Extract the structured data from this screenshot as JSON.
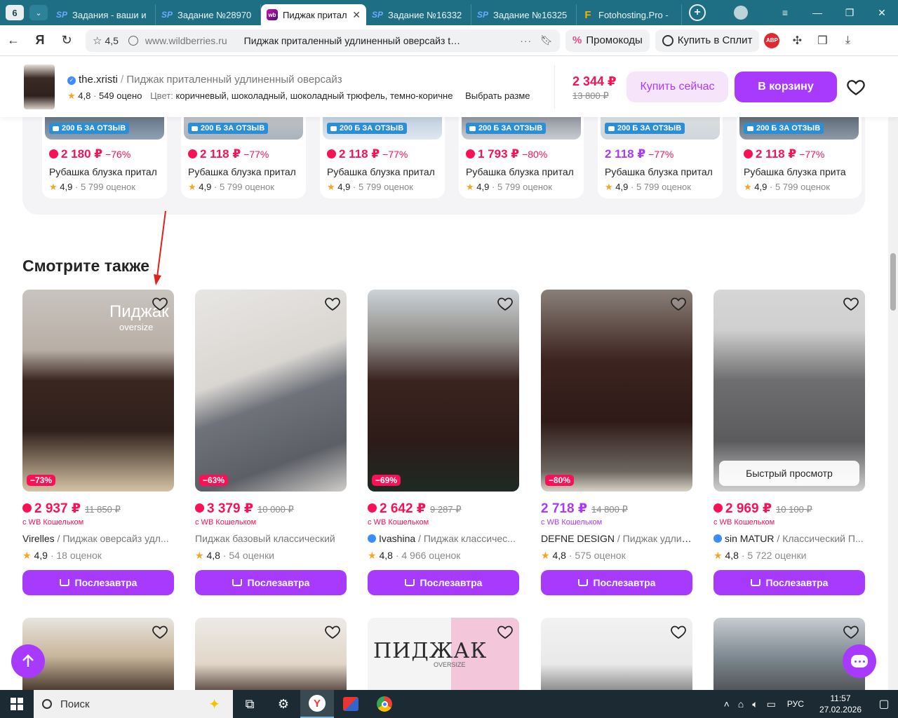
{
  "browser": {
    "tab_count": "6",
    "tabs": [
      {
        "icon": "SP",
        "title": "Задания - ваши и"
      },
      {
        "icon": "SP",
        "title": "Задание №28970"
      },
      {
        "icon": "wb",
        "title": "Пиджак притал"
      },
      {
        "icon": "SP",
        "title": "Задание №16332"
      },
      {
        "icon": "SP",
        "title": "Задание №16325"
      },
      {
        "icon": "F",
        "title": "Fotohosting.Pro -"
      }
    ],
    "site_rating": "4,5",
    "domain": "www.wildberries.ru",
    "page_title": "Пиджак приталенный удлиненный оверсайз t…",
    "promo_label": "Промокоды",
    "split_label": "Купить в Сплит",
    "abp_label": "ABP"
  },
  "sticky": {
    "brand": "the.xristi",
    "product_name": "Пиджак приталенный удлиненный оверсайз",
    "rating": "4,8",
    "reviews": "549 оцено",
    "color_label": "Цвет:",
    "colors": "коричневый, шоколадный, шоколадный трюфель, темно-коричне",
    "size_label": "Выбрать разме",
    "price": "2 344 ₽",
    "old_price": "13 800 ₽",
    "buy_now": "Купить сейчас",
    "to_cart": "В корзину"
  },
  "carousel": [
    {
      "badge": "200 Б ЗА ОТЗЫВ",
      "price": "2 180 ₽",
      "discount": "−76%",
      "name": "Рубашка блузка притал",
      "rating": "4,9",
      "reviews": "5 799 оценок",
      "wallet": true
    },
    {
      "badge": "200 Б ЗА ОТЗЫВ",
      "price": "2 118 ₽",
      "discount": "−77%",
      "name": "Рубашка блузка притал",
      "rating": "4,9",
      "reviews": "5 799 оценок",
      "wallet": true
    },
    {
      "badge": "200 Б ЗА ОТЗЫВ",
      "price": "2 118 ₽",
      "discount": "−77%",
      "name": "Рубашка блузка притал",
      "rating": "4,9",
      "reviews": "5 799 оценок",
      "wallet": true
    },
    {
      "badge": "200 Б ЗА ОТЗЫВ",
      "price": "1 793 ₽",
      "discount": "−80%",
      "name": "Рубашка блузка притал",
      "rating": "4,9",
      "reviews": "5 799 оценок",
      "wallet": true
    },
    {
      "badge": "200 Б ЗА ОТЗЫВ",
      "price": "2 118 ₽",
      "discount": "−77%",
      "name": "Рубашка блузка притал",
      "rating": "4,9",
      "reviews": "5 799 оценок",
      "wallet": false
    },
    {
      "badge": "200 Б ЗА ОТЗЫВ",
      "price": "2 118 ₽",
      "discount": "−77%",
      "name": "Рубашка блузка прита",
      "rating": "4,9",
      "reviews": "5 799 оценок",
      "wallet": true
    }
  ],
  "section_title": "Смотрите также",
  "products": [
    {
      "discount": "−73%",
      "price": "2 937 ₽",
      "old_price": "11 850 ₽",
      "wallet": "с WB Кошельком",
      "brand": "Virelles",
      "name": " / Пиджак оверсайз удл...",
      "verified": false,
      "rating": "4,9",
      "reviews": "18 оценок",
      "deliver": "Послезавтра",
      "overlay_title": "Пиджак",
      "overlay_sub": "oversize",
      "purple": false
    },
    {
      "discount": "−63%",
      "price": "3 379 ₽",
      "old_price": "10 000 ₽",
      "wallet": "с WB Кошельком",
      "brand": "",
      "name": "Пиджак базовый классический",
      "verified": false,
      "rating": "4,8",
      "reviews": "54 оценки",
      "deliver": "Послезавтра",
      "purple": false
    },
    {
      "discount": "−69%",
      "price": "2 642 ₽",
      "old_price": "9 287 ₽",
      "wallet": "с WB Кошельком",
      "brand": "Ivashina",
      "name": " / Пиджак классичес...",
      "verified": true,
      "rating": "4,8",
      "reviews": "4 966 оценок",
      "deliver": "Послезавтра",
      "purple": false
    },
    {
      "discount": "−80%",
      "price": "2 718 ₽",
      "old_price": "14 800 ₽",
      "wallet": "с WB Кошельком",
      "brand": "DEFNE DESIGN",
      "name": " / Пиджак удлин...",
      "verified": false,
      "rating": "4,8",
      "reviews": "575 оценок",
      "deliver": "Послезавтра",
      "purple": true
    },
    {
      "discount": "",
      "price": "2 969 ₽",
      "old_price": "10 100 ₽",
      "wallet": "с WB Кошельком",
      "brand": "sin MATUR",
      "name": " / Классический П...",
      "verified": true,
      "rating": "4,8",
      "reviews": "5 722 оценки",
      "deliver": "Послезавтра",
      "quick_view": "Быстрый просмотр",
      "purple": false
    }
  ],
  "second_row_overlay": {
    "title": "ПИДЖАК",
    "sub": "OVERSIZE"
  },
  "taskbar": {
    "search_placeholder": "Поиск",
    "lang": "РУС",
    "time": "11:57",
    "date": "27.02.2026"
  },
  "colors": {
    "accent": "#a73afd",
    "price_red": "#f91155",
    "tab_bar": "#1e6e84"
  }
}
